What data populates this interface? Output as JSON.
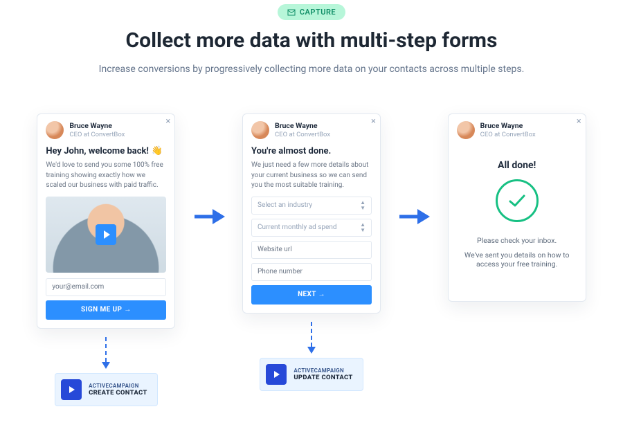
{
  "badge": {
    "label": "CAPTURE"
  },
  "headline": "Collect more data with multi-step forms",
  "sub": "Increase conversions by progressively collecting more data on your contacts across multiple steps.",
  "cards": [
    {
      "author": {
        "name": "Bruce Wayne",
        "role": "CEO at ConvertBox"
      },
      "heading": "Hey John, welcome back!",
      "body": "We'd love to send you some 100% free training showing exactly how we scaled our business with paid traffic.",
      "emailPlaceholder": "your@email.com",
      "cta": "SIGN ME UP →"
    },
    {
      "author": {
        "name": "Bruce Wayne",
        "role": "CEO at ConvertBox"
      },
      "heading": "You're almost done.",
      "body": "We just need a few more details about your current business so we can send you the most suitable training.",
      "selects": [
        {
          "placeholder": "Select an industry"
        },
        {
          "placeholder": "Current monthly ad spend"
        }
      ],
      "inputs": [
        {
          "placeholder": "Website url"
        },
        {
          "placeholder": "Phone number"
        }
      ],
      "cta": "NEXT →"
    },
    {
      "author": {
        "name": "Bruce Wayne",
        "role": "CEO at ConvertBox"
      },
      "title": "All done!",
      "line1": "Please check your inbox.",
      "line2": "We've sent you details on how to access your free training."
    }
  ],
  "chips": [
    {
      "brand": "ACTIVECAMPAIGN",
      "action": "CREATE CONTACT"
    },
    {
      "brand": "ACTIVECAMPAIGN",
      "action": "UPDATE CONTACT"
    }
  ]
}
